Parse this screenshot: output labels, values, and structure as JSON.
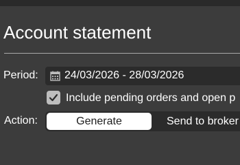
{
  "header": {
    "title": "Account statement"
  },
  "period": {
    "label": "Period:",
    "date_range": "24/03/2026 - 28/03/2026",
    "icon": "calendar-icon"
  },
  "options": {
    "include_pending": {
      "label": "Include pending orders and open p",
      "checked": true
    }
  },
  "action": {
    "label": "Action:",
    "buttons": [
      {
        "label": "Generate",
        "selected": true
      },
      {
        "label": "Send to broker",
        "selected": false
      }
    ]
  },
  "colors": {
    "background": "#3c3c3c",
    "field_background": "#2b2b2b",
    "selected_segment": "#ffffff"
  }
}
